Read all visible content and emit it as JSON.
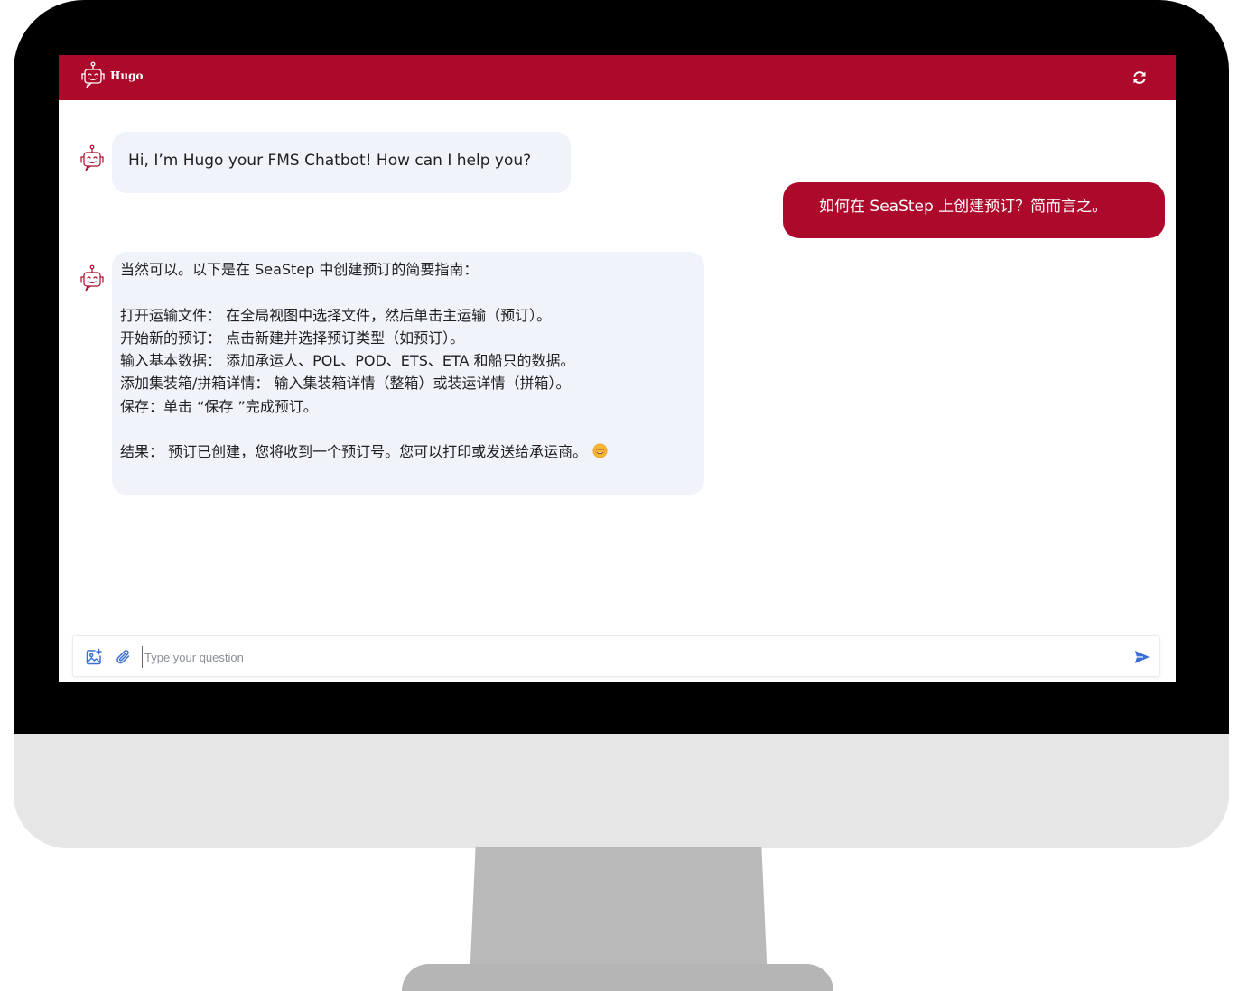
{
  "header": {
    "title": "Hugo",
    "logo_icon": "robot-icon",
    "refresh_icon": "refresh-icon",
    "bar_color": "#ad0a2b"
  },
  "messages": [
    {
      "role": "bot",
      "avatar_icon": "robot-icon",
      "text": "Hi, I’m Hugo your FMS Chatbot! How can I help you?"
    },
    {
      "role": "user",
      "text": "如何在 SeaStep 上创建预订？简而言之。"
    },
    {
      "role": "bot",
      "avatar_icon": "robot-icon",
      "lines": [
        "当然可以。以下是在 SeaStep 中创建预订的简要指南：",
        "",
        "打开运输文件： 在全局视图中选择文件，然后单击主运输（预订）。",
        "开始新的预订： 点击新建并选择预订类型（如预订）。",
        "输入基本数据： 添加承运人、POL、POD、ETS、ETA 和船只的数据。",
        "添加集装箱/拼箱详情： 输入集装箱详情（整箱）或装运详情（拼箱）。",
        "保存：单击 “保存 ”完成预订。",
        "",
        "结果： 预订已创建，您将收到一个预订号。您可以打印或发送给承运商。"
      ],
      "trailing_icon": "smiling-face-emoji-icon"
    }
  ],
  "composer": {
    "placeholder": "Type your question",
    "value": "",
    "add_image_icon": "image-add-icon",
    "attach_icon": "paperclip-icon",
    "send_icon": "send-icon",
    "icon_color": "#3b6fd6"
  }
}
